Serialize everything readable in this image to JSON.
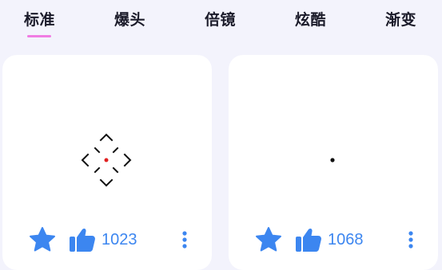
{
  "tabs": [
    {
      "label": "标准",
      "selected": true
    },
    {
      "label": "爆头",
      "selected": false
    },
    {
      "label": "倍镜",
      "selected": false
    },
    {
      "label": "炫酷",
      "selected": false
    },
    {
      "label": "渐变",
      "selected": false
    }
  ],
  "colors": {
    "accent": "#3c86f0",
    "tab_indicator": "#f07ce3",
    "crosshair_center": "#e02020",
    "background": "#f3f3fc"
  },
  "cards": [
    {
      "preview": "crosshair-diamond-icon",
      "favorite_icon": "star-icon",
      "like_icon": "thumbs-up-icon",
      "likes": "1023",
      "more_icon": "more-vertical-icon"
    },
    {
      "preview": "crosshair-dot-icon",
      "favorite_icon": "star-icon",
      "like_icon": "thumbs-up-icon",
      "likes": "1068",
      "more_icon": "more-vertical-icon"
    }
  ]
}
